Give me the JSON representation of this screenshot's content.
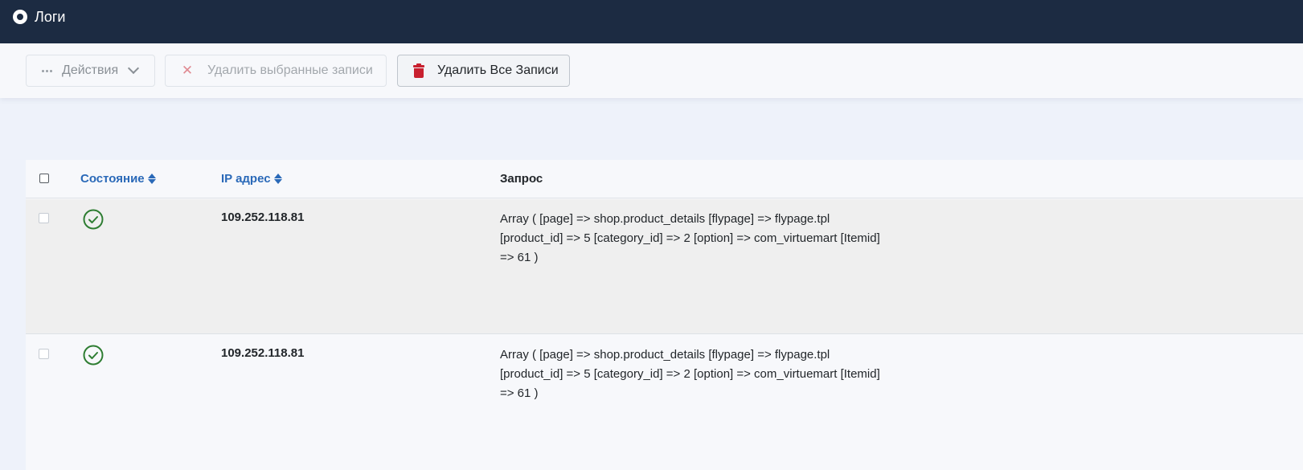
{
  "header": {
    "title": "Логи"
  },
  "toolbar": {
    "actions_label": "Действия",
    "delete_selected_label": "Удалить выбранные записи",
    "delete_all_label": "Удалить Все Записи"
  },
  "table": {
    "columns": {
      "state": "Состояние",
      "ip": "IP адрес",
      "request": "Запрос"
    },
    "rows": [
      {
        "ip": "109.252.118.81",
        "request_lines": [
          "Array ( [page] => shop.product_details [flypage] => flypage.tpl",
          "[product_id] => 5 [category_id] => 2 [option] => com_virtuemart [Itemid]",
          "=> 61 )"
        ]
      },
      {
        "ip": "109.252.118.81",
        "request_lines": [
          "Array ( [page] => shop.product_details [flypage] => flypage.tpl",
          "[product_id] => 5 [category_id] => 2 [option] => com_virtuemart [Itemid]",
          "=> 61 )"
        ]
      }
    ]
  },
  "colors": {
    "header_bg": "#1c2b42",
    "link": "#2a69b8",
    "success": "#2e7d32",
    "danger": "#c8202f"
  }
}
